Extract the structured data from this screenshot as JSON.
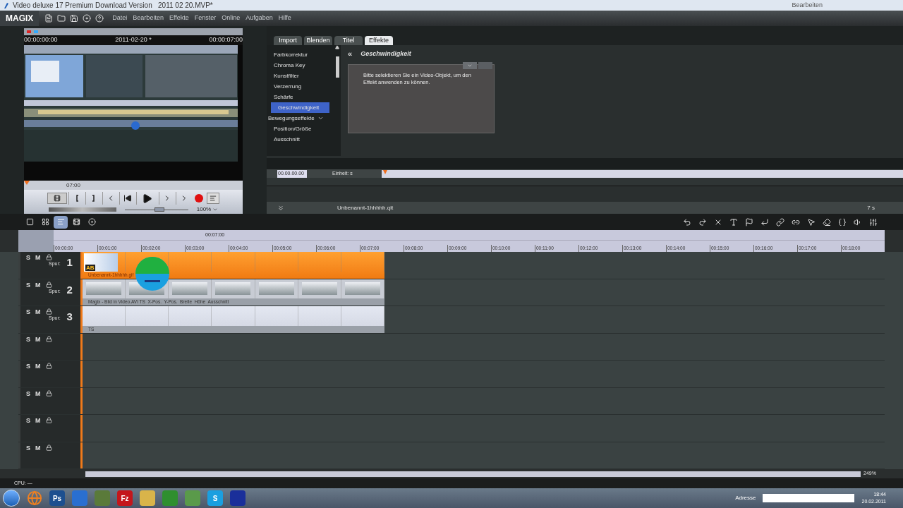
{
  "window": {
    "title": "Video deluxe 17 Premium Download Version   2011 02 20.MVP*",
    "right_item": "Bearbeiten"
  },
  "menu": {
    "logo": "MAGIX",
    "items": [
      "Datei",
      "Bearbeiten",
      "Effekte",
      "Fenster",
      "Online",
      "Aufgaben",
      "Hilfe"
    ]
  },
  "preview": {
    "start_time": "00:00:00:00",
    "project": "2011-02-20 *",
    "end_time": "00:00:07:00",
    "ruler_label": "07:00",
    "zoom": "100%",
    "level": 0.55
  },
  "media_pool": {
    "tabs": [
      {
        "label": "Import",
        "selected": false
      },
      {
        "label": "Blenden",
        "selected": false
      },
      {
        "label": "Titel",
        "selected": false
      },
      {
        "label": "Effekte",
        "selected": true
      }
    ],
    "categories": [
      {
        "label": "Farbkorrektur",
        "kind": "item",
        "selected": false
      },
      {
        "label": "Chroma Key",
        "kind": "item",
        "selected": false
      },
      {
        "label": "Kunstfilter",
        "kind": "item",
        "selected": false
      },
      {
        "label": "Verzerrung",
        "kind": "item",
        "selected": false
      },
      {
        "label": "Schärfe",
        "kind": "item",
        "selected": false
      },
      {
        "label": "Geschwindigkeit",
        "kind": "item",
        "selected": true
      },
      {
        "label": "Bewegungseffekte",
        "kind": "group",
        "selected": false
      },
      {
        "label": "Position/Größe",
        "kind": "item",
        "selected": false
      },
      {
        "label": "Ausschnitt",
        "kind": "item",
        "selected": false
      }
    ],
    "panel": {
      "back": "«",
      "title": "Geschwindigkeit",
      "message": "Bitte selektieren Sie ein Video-Objekt, um den Effekt anwenden zu können."
    },
    "timecode": "00.00.00.00",
    "unit": "Einheit: s",
    "file": "Unbenannt-1hhhhh.qit",
    "duration": "7 s"
  },
  "timeline": {
    "marker": "00:07:00",
    "ticks": [
      "00:00:00",
      "00:01:00",
      "00:02:00",
      "00:03:00",
      "00:04:00",
      "00:05:00",
      "00:06:00",
      "00:07:00",
      "00:08:00",
      "00:09:00",
      "00:10:00",
      "00:11:00",
      "00:12:00",
      "00:13:00",
      "00:14:00",
      "00:15:00",
      "00:16:00",
      "00:17:00",
      "00:18:00"
    ],
    "tracks": [
      {
        "solo": "S",
        "mute": "M",
        "label": "Spur:",
        "number": "1",
        "clip": {
          "kind": "title",
          "caption": "Unbenannt-1hhhhh.gif",
          "badge": "AB"
        }
      },
      {
        "solo": "S",
        "mute": "M",
        "label": "Spur:",
        "number": "2",
        "clip": {
          "kind": "video",
          "caption": "Magix - Bild in Video.AVI TS  X-Pos.  Y-Pos.  Breite  Höhe  Ausschnitt"
        }
      },
      {
        "solo": "S",
        "mute": "M",
        "label": "Spur:",
        "number": "3",
        "clip": {
          "kind": "light",
          "caption": "TS"
        }
      },
      {
        "solo": "S",
        "mute": "M"
      },
      {
        "solo": "S",
        "mute": "M"
      },
      {
        "solo": "S",
        "mute": "M"
      },
      {
        "solo": "S",
        "mute": "M"
      },
      {
        "solo": "S",
        "mute": "M"
      }
    ],
    "zoom": "249%"
  },
  "status": "CPU: —",
  "taskbar": {
    "apps": [
      {
        "kind": "orb"
      },
      {
        "kind": "globe"
      },
      {
        "kind": "tile",
        "label": "Ps",
        "color": "#1d4f8f"
      },
      {
        "kind": "tile",
        "color": "#2a6fd0"
      },
      {
        "kind": "tile",
        "color": "#5a7a3a"
      },
      {
        "kind": "tile",
        "label": "Fz",
        "color": "#c4161c"
      },
      {
        "kind": "tile",
        "color": "#d9b44a"
      },
      {
        "kind": "tile",
        "color": "#2f8f2f"
      },
      {
        "kind": "tile",
        "color": "#5a9a4a"
      },
      {
        "kind": "tile",
        "label": "S",
        "color": "#1a9fe0"
      },
      {
        "kind": "tile",
        "color": "#1a2f9a"
      }
    ],
    "address_label": "Adresse",
    "time": "18:44",
    "date": "20.02.2011"
  }
}
